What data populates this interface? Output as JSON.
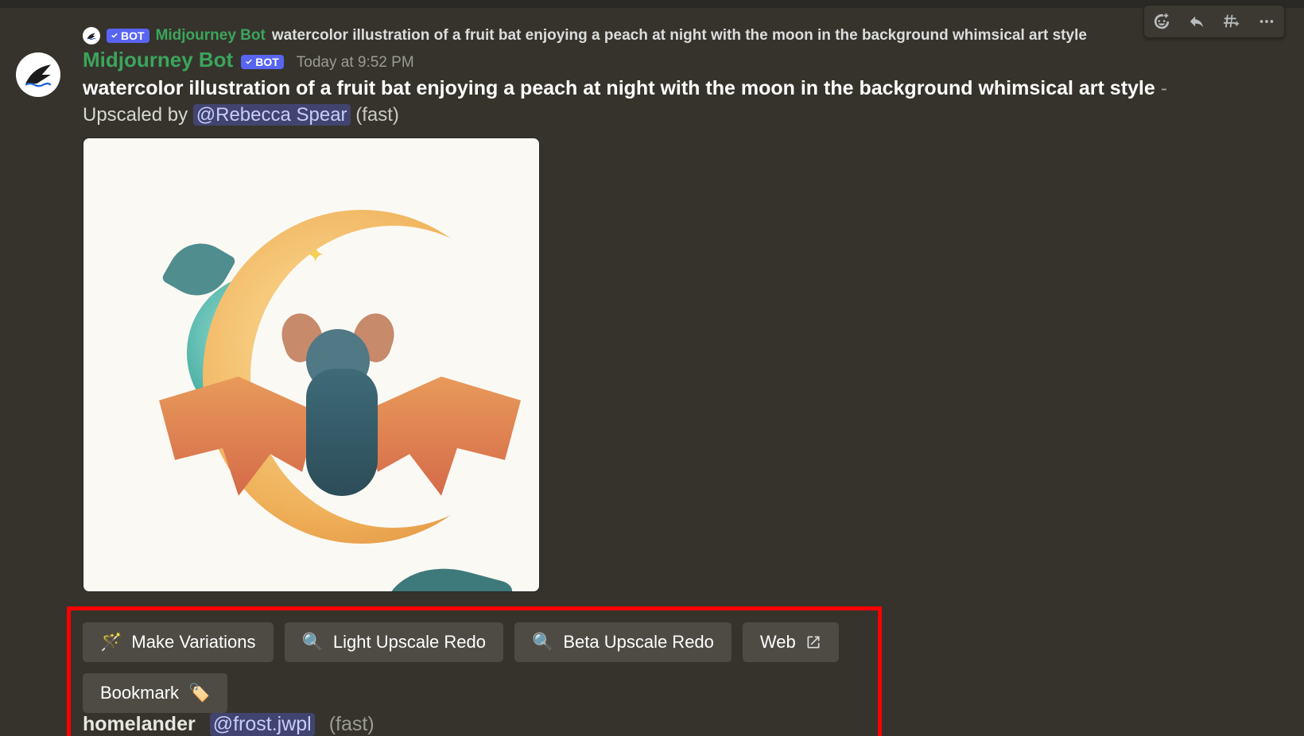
{
  "reply": {
    "bot_tag_text": "BOT",
    "author": "Midjourney Bot",
    "preview": "watercolor illustration of a fruit bat enjoying a peach at night with the moon in the background whimsical art style"
  },
  "message": {
    "author": "Midjourney Bot",
    "bot_tag_text": "BOT",
    "timestamp": "Today at 9:52 PM",
    "prompt": "watercolor illustration of a fruit bat enjoying a peach at night with the moon in the background whimsical art style",
    "prompt_suffix": " - ",
    "upscaled_prefix": "Upscaled by ",
    "mention": "@Rebecca Spear",
    "mode": " (fast)"
  },
  "actions": {
    "row1": {
      "make_variations": "Make Variations",
      "light_upscale_redo": "Light Upscale Redo",
      "beta_upscale_redo": "Beta Upscale Redo",
      "web": "Web"
    },
    "row2": {
      "bookmark": "Bookmark"
    }
  },
  "next_message": {
    "author": "homelander",
    "mention": "@frost.jwpl",
    "mode": "(fast)"
  },
  "hover_icons": {
    "react": "add-reaction-icon",
    "reply": "reply-icon",
    "thread": "create-thread-icon",
    "more": "more-icon"
  }
}
